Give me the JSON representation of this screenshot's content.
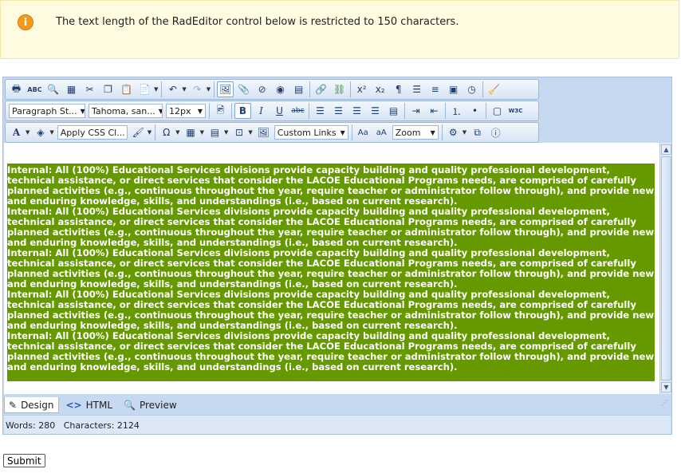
{
  "info": {
    "icon": "info-icon",
    "message": "The text length of the RadEditor control below is restricted to 150 characters."
  },
  "toolbar": {
    "paragraph_style": "Paragraph St...",
    "font_name": "Tahoma, san...",
    "font_size": "12px",
    "css_class": "Apply CSS Cl...",
    "custom_links": "Custom Links",
    "zoom": "Zoom"
  },
  "content": {
    "paragraph": "Internal: All (100%) Educational Services divisions provide capacity building and quality professional development, technical assistance, or direct services that consider the LACOE Educational Programs needs, are comprised of carefully planned activities (e.g., continuous throughout the year, require teacher or administrator follow through), and provide new and enduring knowledge, skills, and understandings (i.e., based on current research).",
    "repeat_count": 5
  },
  "modes": {
    "design": "Design",
    "html": "HTML",
    "preview": "Preview"
  },
  "stats": {
    "text": "Words: 280   Characters: 2124"
  },
  "submit_label": "Submit"
}
